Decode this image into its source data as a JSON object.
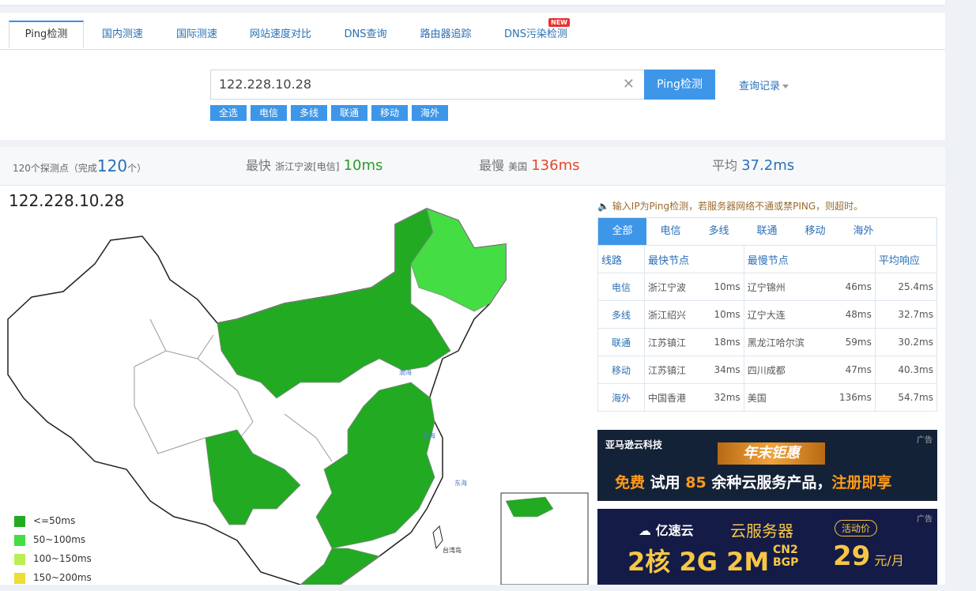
{
  "tabs": [
    {
      "label": "Ping检测",
      "active": true
    },
    {
      "label": "国内测速"
    },
    {
      "label": "国际测速"
    },
    {
      "label": "网站速度对比"
    },
    {
      "label": "DNS查询"
    },
    {
      "label": "路由器追踪"
    },
    {
      "label": "DNS污染检测"
    }
  ],
  "new_badge": "NEW",
  "search": {
    "value": "122.228.10.28",
    "button": "Ping检测",
    "history": "查询记录"
  },
  "filters": [
    "全选",
    "电信",
    "多线",
    "联通",
    "移动",
    "海外"
  ],
  "summary": {
    "nodes_prefix": "120个探测点（完成",
    "nodes_count": "120",
    "nodes_suffix": "个）",
    "fastest_label": "最快",
    "fastest_node": "浙江宁波[电信]",
    "fastest_value": "10ms",
    "slowest_label": "最慢",
    "slowest_node": "美国",
    "slowest_value": "136ms",
    "avg_label": "平均",
    "avg_value": "37.2ms"
  },
  "map_title": "122.228.10.28",
  "legend": [
    {
      "label": "<=50ms",
      "color": "#22aa22"
    },
    {
      "label": "50~100ms",
      "color": "#44dd44"
    },
    {
      "label": "100~150ms",
      "color": "#bbee55"
    },
    {
      "label": "150~200ms",
      "color": "#eedd33"
    }
  ],
  "map_labels": {
    "bohai": "渤海",
    "huanghai": "黄海",
    "donghai": "东海",
    "taiwan": "台湾岛"
  },
  "notice": "输入IP为Ping检测，若服务器网络不通或禁PING，则超时。",
  "result_tabs": [
    "全部",
    "电信",
    "多线",
    "联通",
    "移动",
    "海外"
  ],
  "table": {
    "headers": [
      "线路",
      "最快节点",
      "最慢节点",
      "平均响应"
    ],
    "rows": [
      {
        "line": "电信",
        "fast": "浙江宁波",
        "fast_ms": "10ms",
        "slow": "辽宁锦州",
        "slow_ms": "46ms",
        "avg": "25.4ms"
      },
      {
        "line": "多线",
        "fast": "浙江绍兴",
        "fast_ms": "10ms",
        "slow": "辽宁大连",
        "slow_ms": "48ms",
        "avg": "32.7ms"
      },
      {
        "line": "联通",
        "fast": "江苏镇江",
        "fast_ms": "18ms",
        "slow": "黑龙江哈尔滨",
        "slow_ms": "59ms",
        "avg": "30.2ms"
      },
      {
        "line": "移动",
        "fast": "江苏镇江",
        "fast_ms": "34ms",
        "slow": "四川成都",
        "slow_ms": "47ms",
        "avg": "40.3ms"
      },
      {
        "line": "海外",
        "fast": "中国香港",
        "fast_ms": "32ms",
        "slow": "美国",
        "slow_ms": "136ms",
        "avg": "54.7ms"
      }
    ]
  },
  "ad1": {
    "tag": "广告",
    "brand": "亚马逊云科技",
    "headline": "年末钜惠",
    "text1": "免费",
    "text2": "试用",
    "num": "85",
    "text3": "余种云服务产品，",
    "text4": "注册即享"
  },
  "ad2": {
    "tag": "广告",
    "brand": "亿速云",
    "title": "云服务器",
    "badge": "活动价",
    "spec1": "2核",
    "spec2": "2G",
    "spec3": "2M",
    "cn2": "CN2",
    "bgp": "BGP",
    "price": "29",
    "unit": "元/月"
  }
}
